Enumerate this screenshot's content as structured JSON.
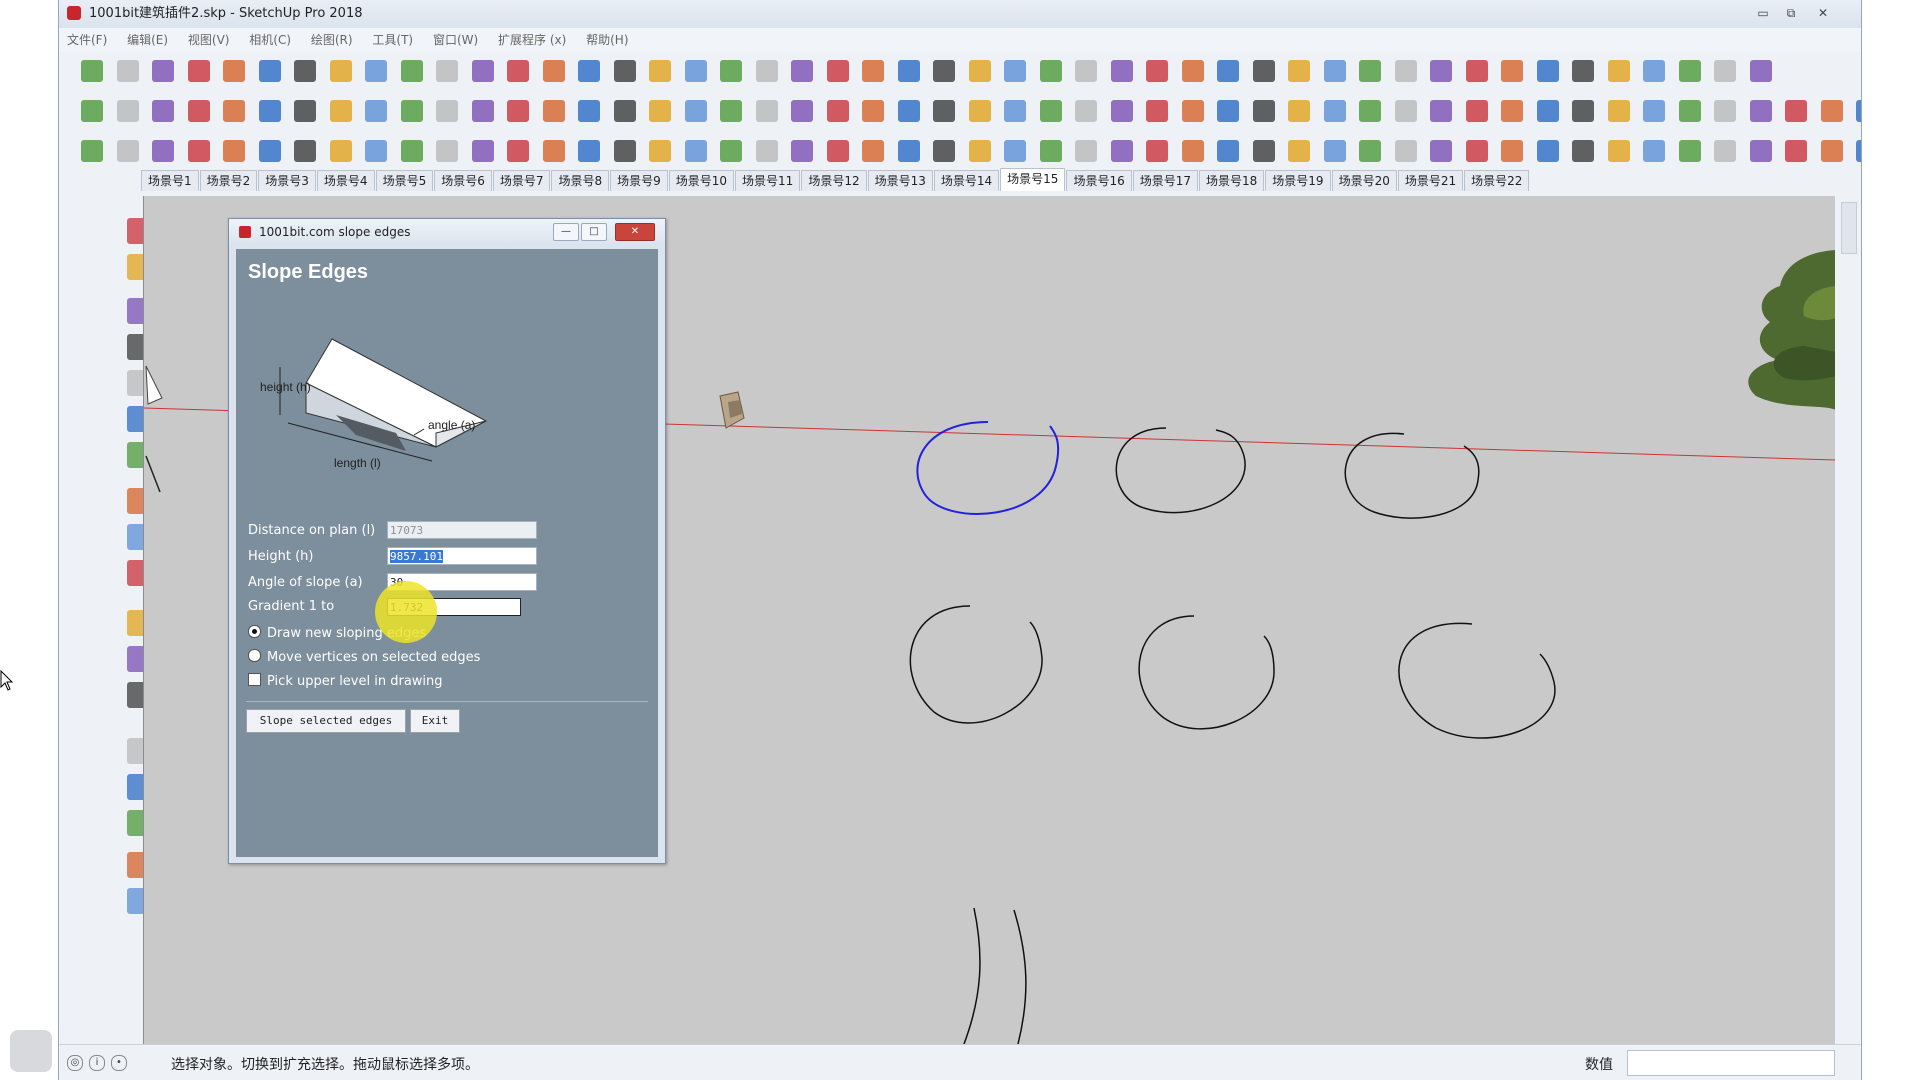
{
  "window": {
    "title": "1001bit建筑插件2.skp - SketchUp Pro 2018",
    "controls": {
      "minimize": "▭",
      "restore": "⧉",
      "close": "✕"
    }
  },
  "menu": [
    "文件(F)",
    "编辑(E)",
    "视图(V)",
    "相机(C)",
    "绘图(R)",
    "工具(T)",
    "窗口(W)",
    "扩展程序 (x)",
    "帮助(H)"
  ],
  "scene_tabs": [
    "场景号1",
    "场景号2",
    "场景号3",
    "场景号4",
    "场景号5",
    "场景号6",
    "场景号7",
    "场景号8",
    "场景号9",
    "场景号10",
    "场景号11",
    "场景号12",
    "场景号13",
    "场景号14",
    "场景号15",
    "场景号16",
    "场景号17",
    "场景号18",
    "场景号19",
    "场景号20",
    "场景号21",
    "场景号22"
  ],
  "active_scene_index": 14,
  "dialog": {
    "title": "1001bit.com slope edges",
    "heading": "Slope Edges",
    "diagram_labels": {
      "height": "height (h)",
      "angle": "angle (a)",
      "length": "length (l)"
    },
    "fields": {
      "distance": {
        "label": "Distance on plan (l)",
        "value": "17073"
      },
      "height": {
        "label": "Height (h)",
        "value": "9857.101"
      },
      "angle": {
        "label": "Angle of slope (a)",
        "value": "30"
      },
      "gradient": {
        "label": "Gradient 1 to",
        "value": "1.732"
      }
    },
    "options": {
      "draw_new": "Draw new sloping edges",
      "move_vertices": "Move vertices on selected edges",
      "pick_upper": "Pick upper level in drawing"
    },
    "buttons": {
      "slope": "Slope selected edges",
      "exit": "Exit"
    }
  },
  "status": {
    "message": "选择对象。切换到扩充选择。拖动鼠标选择多项。",
    "measurements_label": "数值"
  },
  "colors": {
    "viewport": "#c9c9c9",
    "dialog_body": "#7d8e9d",
    "selected_arc": "#2222dd",
    "axis_red": "#cc3333"
  }
}
